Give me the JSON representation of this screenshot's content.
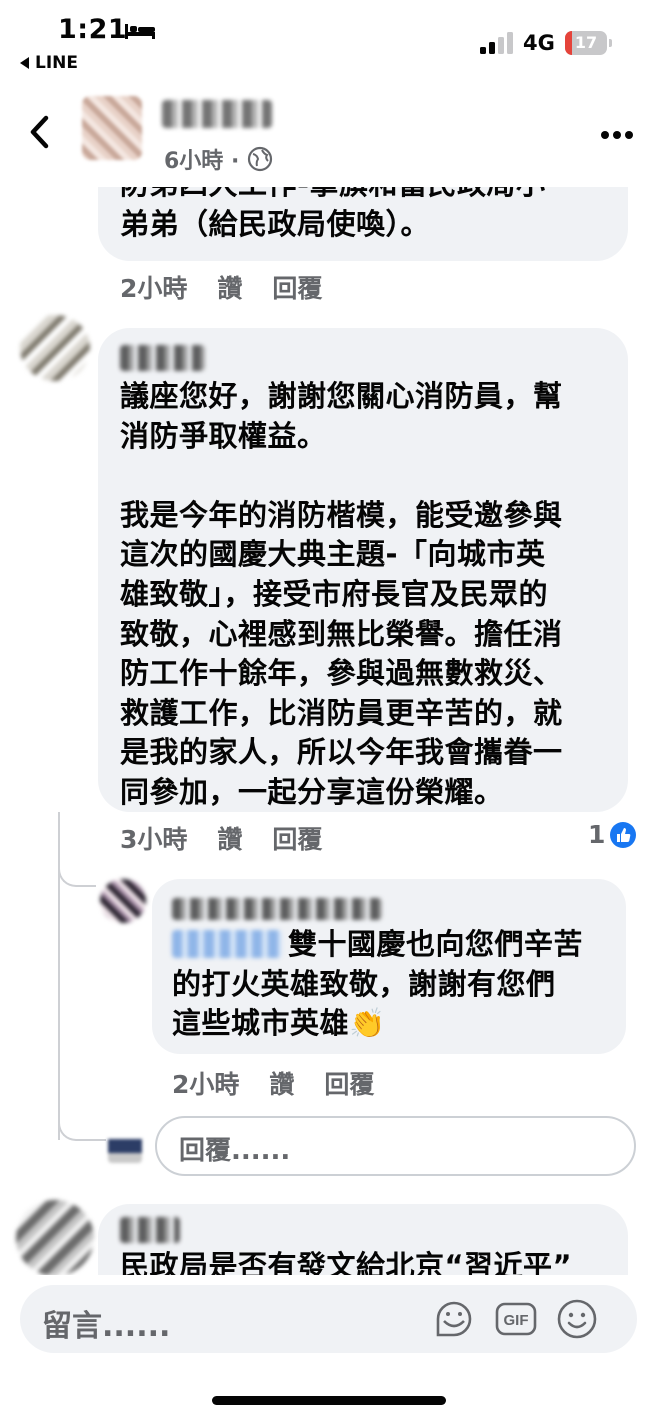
{
  "status_bar": {
    "time": "1:21",
    "back_app": "LINE",
    "network": "4G",
    "battery_level": "17",
    "battery_fraction": 0.17,
    "icons": [
      "bed-icon",
      "signal-icon",
      "battery-icon"
    ]
  },
  "header": {
    "post_time": "6小時 ·",
    "icons": [
      "back-arrow-icon",
      "globe-icon",
      "more-icon"
    ]
  },
  "comments": [
    {
      "text": "防弟四大工作-拿旗和當民政局小\n弟弟（給民政局使喚）。",
      "meta": {
        "time": "2小時",
        "like": "讚",
        "reply": "回覆"
      }
    },
    {
      "text": "議座您好，謝謝您關心消防員，幫\n消防爭取權益。\n\n我是今年的消防楷模，能受邀參與\n這次的國慶大典主題-「向城市英\n雄致敬」，接受市府長官及民眾的\n致敬，心裡感到無比榮譽。擔任消\n防工作十餘年，參與過無數救災、\n救護工作，比消防員更辛苦的，就\n是我的家人，所以今年我會攜眷一\n同參加，一起分享這份榮耀。",
      "meta": {
        "time": "3小時",
        "like": "讚",
        "reply": "回覆"
      },
      "reaction_count": "1",
      "reply": {
        "text": "雙十國慶也向您們辛苦\n的打火英雄致敬，謝謝有您們\n這些城市英雄👏",
        "meta": {
          "time": "2小時",
          "like": "讚",
          "reply": "回覆"
        }
      }
    },
    {
      "text": "民政局是否有發文給北京“習近平”"
    }
  ],
  "reply_input": {
    "placeholder": "回覆......"
  },
  "composer": {
    "placeholder": "留言......",
    "icons": [
      "sticker-icon",
      "gif-icon",
      "emoji-icon"
    ]
  },
  "colors": {
    "bubble": "#f0f2f5",
    "secondary_text": "#65676b",
    "like_blue": "#1877f2",
    "battery_red": "#e5433a"
  }
}
